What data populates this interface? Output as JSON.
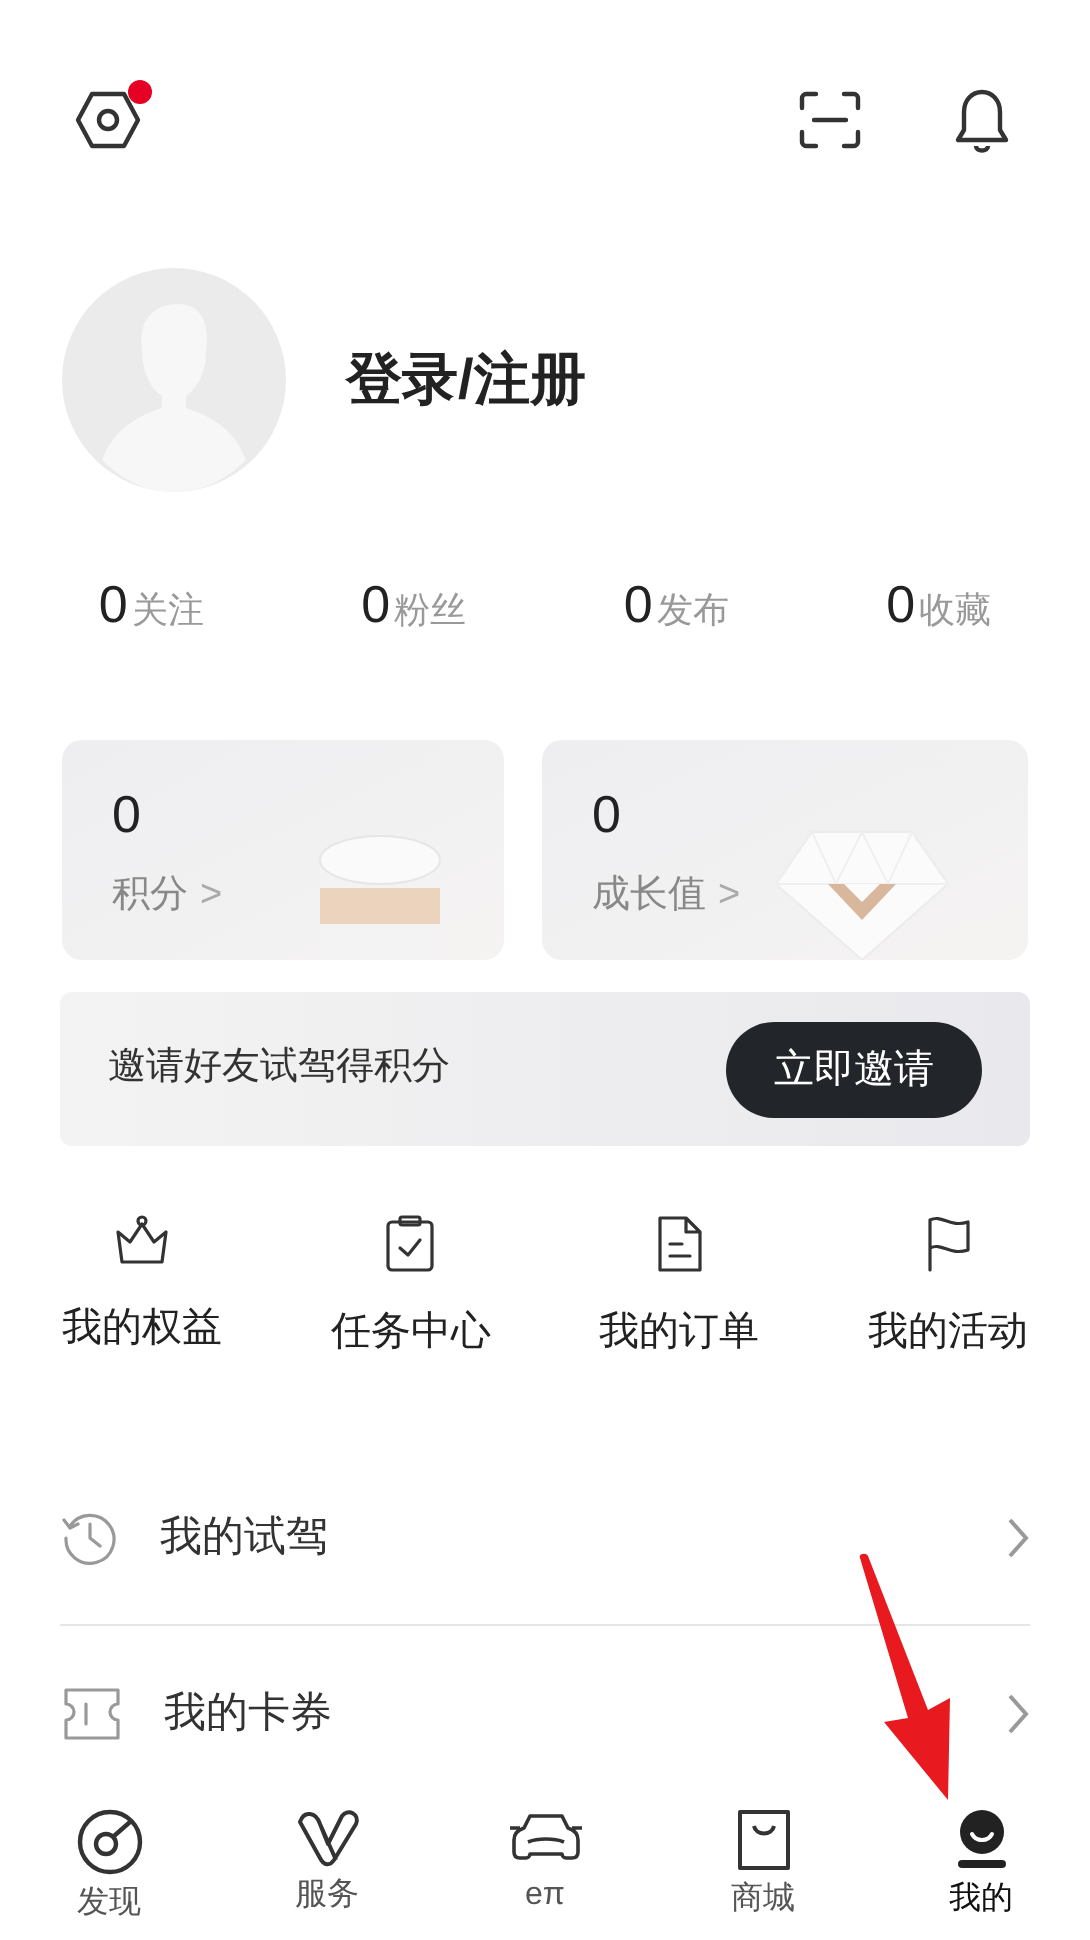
{
  "header": {
    "settings_badge": true
  },
  "profile": {
    "login": "登录/注册"
  },
  "stats": [
    {
      "value": "0",
      "label": "关注"
    },
    {
      "value": "0",
      "label": "粉丝"
    },
    {
      "value": "0",
      "label": "发布"
    },
    {
      "value": "0",
      "label": "收藏"
    }
  ],
  "cards": [
    {
      "kind": "coin",
      "value": "0",
      "label": "积分",
      "arrow": ">"
    },
    {
      "kind": "diamond",
      "value": "0",
      "label": "成长值",
      "arrow": ">"
    }
  ],
  "invite": {
    "text": "邀请好友试驾得积分",
    "button": "立即邀请"
  },
  "shortcuts": [
    {
      "kind": "crown",
      "label": "我的权益"
    },
    {
      "kind": "clipboard",
      "label": "任务中心"
    },
    {
      "kind": "document",
      "label": "我的订单"
    },
    {
      "kind": "flag",
      "label": "我的活动"
    }
  ],
  "list": [
    {
      "kind": "history",
      "label": "我的试驾"
    },
    {
      "kind": "ticket",
      "label": "我的卡券"
    }
  ],
  "tab_bar": [
    {
      "kind": "discover",
      "label": "发现",
      "selected": false
    },
    {
      "kind": "service",
      "label": "服务",
      "selected": false
    },
    {
      "kind": "car",
      "label": "eπ",
      "selected": false
    },
    {
      "kind": "shop",
      "label": "商城",
      "selected": false
    },
    {
      "kind": "me",
      "label": "我的",
      "selected": true
    }
  ]
}
